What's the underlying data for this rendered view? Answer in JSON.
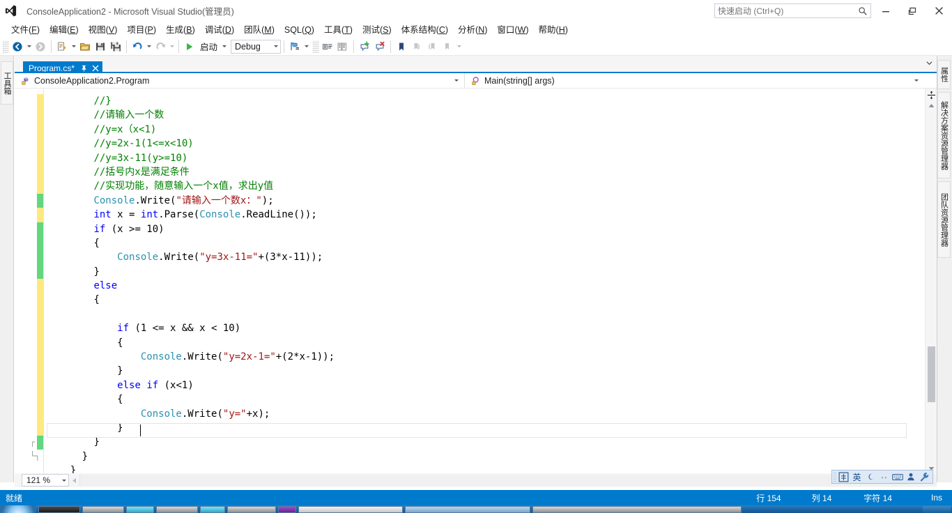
{
  "window": {
    "title": "ConsoleApplication2 - Microsoft Visual Studio(管理员)",
    "logo_icon": "visual-studio-logo",
    "minimize_icon": "minimize-icon",
    "maximize_icon": "maximize-icon",
    "close_icon": "close-icon"
  },
  "quick_launch": {
    "placeholder": "快速启动 (Ctrl+Q)",
    "value": "",
    "icon": "search-icon"
  },
  "menu": {
    "items": [
      {
        "label": "文件",
        "accel": "F"
      },
      {
        "label": "编辑",
        "accel": "E"
      },
      {
        "label": "视图",
        "accel": "V"
      },
      {
        "label": "项目",
        "accel": "P"
      },
      {
        "label": "生成",
        "accel": "B"
      },
      {
        "label": "调试",
        "accel": "D"
      },
      {
        "label": "团队",
        "accel": "M"
      },
      {
        "label": "SQL",
        "accel": "Q"
      },
      {
        "label": "工具",
        "accel": "T"
      },
      {
        "label": "测试",
        "accel": "S"
      },
      {
        "label": "体系结构",
        "accel": "C"
      },
      {
        "label": "分析",
        "accel": "N"
      },
      {
        "label": "窗口",
        "accel": "W"
      },
      {
        "label": "帮助",
        "accel": "H"
      }
    ]
  },
  "toolbar": {
    "navigate_back_icon": "navigate-back-icon",
    "navigate_forward_icon": "navigate-forward-icon",
    "new_project_icon": "new-project-icon",
    "open_file_icon": "open-file-icon",
    "save_icon": "save-icon",
    "save_all_icon": "save-all-icon",
    "undo_icon": "undo-icon",
    "redo_icon": "redo-icon",
    "start_icon": "start-debug-icon",
    "start_label": "启动",
    "config_value": "Debug",
    "attach_icon": "attach-to-process-icon",
    "comment_icon": "comment-selection-icon",
    "uncomment_icon": "uncomment-selection-icon",
    "add_bookmark_icon": "add-breakpoint-icon",
    "remove_bookmark_icon": "remove-breakpoint-icon",
    "bookmark_icon": "bookmark-icon",
    "prev_bookmark_icon": "previous-bookmark-icon",
    "next_bookmark_icon": "next-bookmark-icon",
    "clear_bookmarks_icon": "clear-bookmarks-icon"
  },
  "left_dock": {
    "tab_label": "工具箱"
  },
  "right_dock": {
    "tabs": [
      {
        "label": "属性"
      },
      {
        "label": "解决方案资源管理器"
      },
      {
        "label": "团队资源管理器"
      }
    ]
  },
  "editor_tabs": {
    "active": {
      "title": "Program.cs*",
      "pin_icon": "pin-icon",
      "close_icon": "close-icon"
    },
    "overflow_icon": "chevron-down-icon"
  },
  "navbar": {
    "type_icon": "class-icon",
    "type_value": "ConsoleApplication2.Program",
    "member_icon": "method-icon",
    "member_value": "Main(string[] args)",
    "caret_icon": "chevron-down-icon"
  },
  "code": {
    "lines": [
      {
        "indent": 8,
        "change": "unsaved",
        "tokens": [
          {
            "t": "cmt",
            "s": "//}"
          }
        ]
      },
      {
        "indent": 8,
        "change": "unsaved",
        "tokens": [
          {
            "t": "cmt",
            "s": "//请输入一个数"
          }
        ]
      },
      {
        "indent": 8,
        "change": "unsaved",
        "tokens": [
          {
            "t": "cmt",
            "s": "//y=x（x<1)"
          }
        ]
      },
      {
        "indent": 8,
        "change": "unsaved",
        "tokens": [
          {
            "t": "cmt",
            "s": "//y=2x-1(1<=x<10)"
          }
        ]
      },
      {
        "indent": 8,
        "change": "unsaved",
        "tokens": [
          {
            "t": "cmt",
            "s": "//y=3x-11(y>=10)"
          }
        ]
      },
      {
        "indent": 8,
        "change": "unsaved",
        "tokens": [
          {
            "t": "cmt",
            "s": "//括号内x是满足条件"
          }
        ]
      },
      {
        "indent": 8,
        "change": "unsaved",
        "tokens": [
          {
            "t": "cmt",
            "s": "//实现功能，随意输入一个x值，求出y值"
          }
        ]
      },
      {
        "indent": 8,
        "change": "saved",
        "tokens": [
          {
            "t": "typ",
            "s": "Console"
          },
          {
            "t": "pln",
            "s": ".Write("
          },
          {
            "t": "str",
            "s": "\"请输入一个数x："
          },
          {
            "t": "str",
            "s": "\""
          },
          {
            "t": "pln",
            "s": ");"
          }
        ]
      },
      {
        "indent": 8,
        "change": "unsaved",
        "tokens": [
          {
            "t": "kw",
            "s": "int"
          },
          {
            "t": "pln",
            "s": " x = "
          },
          {
            "t": "kw",
            "s": "int"
          },
          {
            "t": "pln",
            "s": ".Parse("
          },
          {
            "t": "typ",
            "s": "Console"
          },
          {
            "t": "pln",
            "s": ".ReadLine());"
          }
        ]
      },
      {
        "indent": 8,
        "change": "saved",
        "tokens": [
          {
            "t": "kw",
            "s": "if"
          },
          {
            "t": "pln",
            "s": " (x >= 10)"
          }
        ]
      },
      {
        "indent": 8,
        "change": "saved",
        "tokens": [
          {
            "t": "pln",
            "s": "{"
          }
        ]
      },
      {
        "indent": 12,
        "change": "saved",
        "tokens": [
          {
            "t": "typ",
            "s": "Console"
          },
          {
            "t": "pln",
            "s": ".Write("
          },
          {
            "t": "str",
            "s": "\"y=3x-11=\""
          },
          {
            "t": "pln",
            "s": "+(3*x-11));"
          }
        ]
      },
      {
        "indent": 8,
        "change": "saved",
        "tokens": [
          {
            "t": "pln",
            "s": "}"
          }
        ]
      },
      {
        "indent": 8,
        "change": "unsaved",
        "tokens": [
          {
            "t": "kw",
            "s": "else"
          }
        ]
      },
      {
        "indent": 8,
        "change": "unsaved",
        "tokens": [
          {
            "t": "pln",
            "s": "{"
          }
        ]
      },
      {
        "indent": 8,
        "change": "unsaved",
        "tokens": [
          {
            "t": "pln",
            "s": ""
          }
        ]
      },
      {
        "indent": 12,
        "change": "unsaved",
        "tokens": [
          {
            "t": "kw",
            "s": "if"
          },
          {
            "t": "pln",
            "s": " (1 <= x && x < 10)"
          }
        ]
      },
      {
        "indent": 12,
        "change": "unsaved",
        "tokens": [
          {
            "t": "pln",
            "s": "{"
          }
        ]
      },
      {
        "indent": 16,
        "change": "unsaved",
        "tokens": [
          {
            "t": "typ",
            "s": "Console"
          },
          {
            "t": "pln",
            "s": ".Write("
          },
          {
            "t": "str",
            "s": "\"y=2x-1=\""
          },
          {
            "t": "pln",
            "s": "+(2*x-1));"
          }
        ]
      },
      {
        "indent": 12,
        "change": "unsaved",
        "tokens": [
          {
            "t": "pln",
            "s": "}"
          }
        ]
      },
      {
        "indent": 12,
        "change": "unsaved",
        "tokens": [
          {
            "t": "kw",
            "s": "else"
          },
          {
            "t": "pln",
            "s": " "
          },
          {
            "t": "kw",
            "s": "if"
          },
          {
            "t": "pln",
            "s": " (x<1)"
          }
        ]
      },
      {
        "indent": 12,
        "change": "unsaved",
        "tokens": [
          {
            "t": "pln",
            "s": "{"
          }
        ]
      },
      {
        "indent": 16,
        "change": "unsaved",
        "tokens": [
          {
            "t": "typ",
            "s": "Console"
          },
          {
            "t": "pln",
            "s": ".Write("
          },
          {
            "t": "str",
            "s": "\"y=\""
          },
          {
            "t": "pln",
            "s": "+x);"
          }
        ]
      },
      {
        "indent": 12,
        "change": "unsaved",
        "tokens": [
          {
            "t": "pln",
            "s": "}"
          }
        ]
      },
      {
        "indent": 8,
        "change": "saved",
        "current": true,
        "tokens": [
          {
            "t": "pln",
            "s": "}"
          }
        ]
      },
      {
        "indent": 6,
        "change": "none",
        "tokens": [
          {
            "t": "pln",
            "s": "}"
          }
        ]
      },
      {
        "indent": 4,
        "change": "none",
        "tokens": [
          {
            "t": "pln",
            "s": "}"
          }
        ]
      }
    ]
  },
  "editor_scrollbar": {
    "split_icon": "split-view-icon",
    "up_icon": "scroll-up-icon",
    "down_icon": "scroll-down-icon"
  },
  "zoom": {
    "value": "121 %",
    "caret_icon": "chevron-down-icon"
  },
  "ime_bar": {
    "buttons": [
      {
        "icon": "ime-mode-icon",
        "label": "中"
      },
      {
        "icon": "ime-english-icon",
        "label": "英"
      },
      {
        "icon": "ime-moon-icon",
        "label": ""
      },
      {
        "icon": "ime-punctuation-icon",
        "label": ""
      },
      {
        "icon": "ime-keyboard-icon",
        "label": ""
      },
      {
        "icon": "ime-user-icon",
        "label": ""
      },
      {
        "icon": "ime-tools-icon",
        "label": ""
      }
    ]
  },
  "status_bar": {
    "ready_label": "就绪",
    "line_label": "行 154",
    "column_label": "列 14",
    "char_label": "字符 14",
    "insert_label": "Ins",
    "accent_color": "#007acc"
  },
  "colors": {
    "accent": "#007acc",
    "comment": "#008000",
    "keyword": "#0000ff",
    "type": "#2b91af",
    "string": "#a31515",
    "change_unsaved": "#ffe97f",
    "change_saved": "#62d77f"
  }
}
